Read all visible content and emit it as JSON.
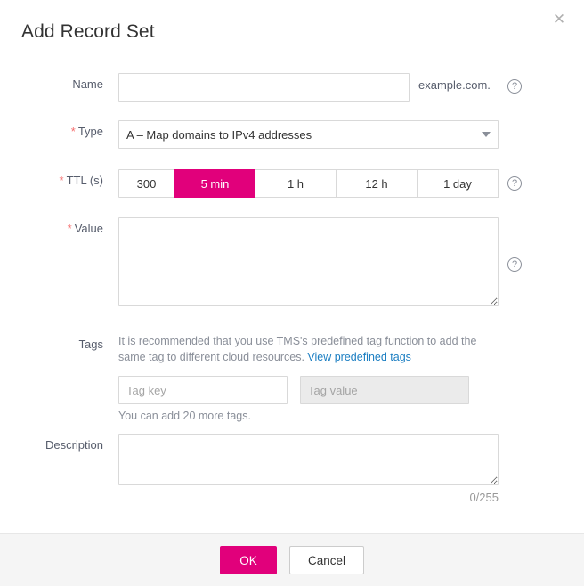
{
  "dialog": {
    "title": "Add Record Set",
    "close_icon": "close-icon"
  },
  "form": {
    "name": {
      "label": "Name",
      "value": "",
      "placeholder": "",
      "suffix": "example.com.",
      "help_icon": "help-circle-icon"
    },
    "type": {
      "label": "Type",
      "required_marker": "*",
      "value": "A – Map domains to IPv4 addresses",
      "caret_icon": "chevron-down-icon"
    },
    "ttl": {
      "label": "TTL (s)",
      "required_marker": "*",
      "value": "300",
      "presets": [
        {
          "label": "5 min",
          "active": true
        },
        {
          "label": "1 h",
          "active": false
        },
        {
          "label": "12 h",
          "active": false
        },
        {
          "label": "1 day",
          "active": false
        }
      ],
      "help_icon": "help-circle-icon"
    },
    "value": {
      "label": "Value",
      "required_marker": "*",
      "text": "",
      "placeholder": "",
      "help_icon": "help-circle-icon"
    },
    "tags": {
      "label": "Tags",
      "hint_before_link": "It is recommended that you use TMS's predefined tag function to add the same tag to different cloud resources. ",
      "link_text": "View predefined tags",
      "key_placeholder": "Tag key",
      "key_value": "",
      "value_placeholder": "Tag value",
      "value_value": "",
      "note": "You can add 20 more tags."
    },
    "description": {
      "label": "Description",
      "text": "",
      "placeholder": "",
      "counter": "0/255"
    }
  },
  "footer": {
    "ok_label": "OK",
    "cancel_label": "Cancel"
  },
  "colors": {
    "accent": "#e1007b",
    "link": "#1b7ec2",
    "required": "#f56c6c",
    "footer_bg": "#f5f5f5"
  }
}
